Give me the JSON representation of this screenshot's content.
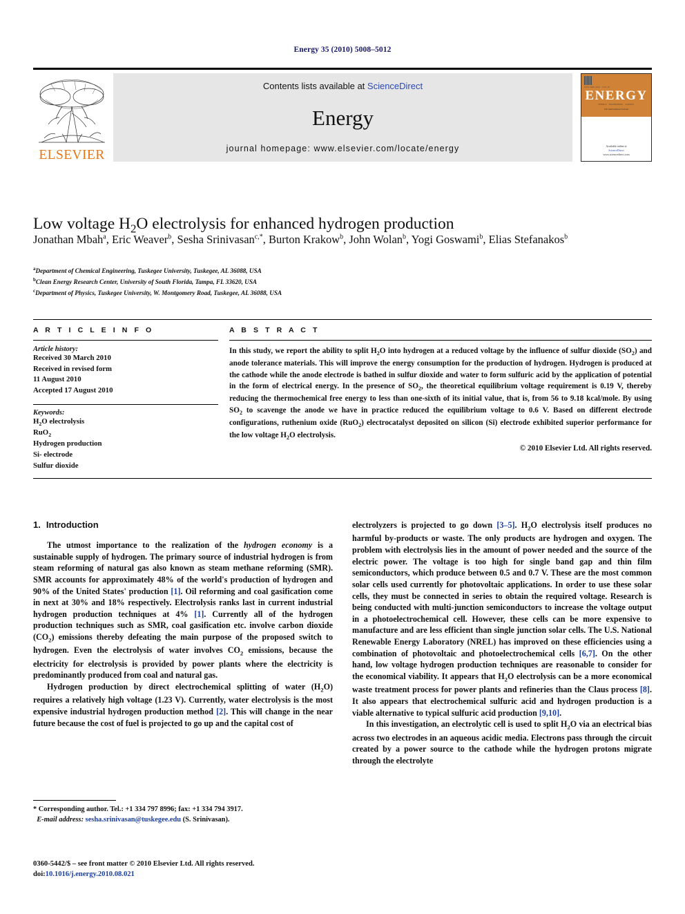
{
  "running_head": "Energy 35 (2010) 5008–5012",
  "masthead": {
    "publisher": "ELSEVIER",
    "contents_prefix": "Contents lists available at ",
    "contents_link": "ScienceDirect",
    "journal_title": "Energy",
    "homepage": "journal homepage: www.elsevier.com/locate/energy",
    "cover": {
      "title": "ENERGY",
      "tagline": "The International Journal",
      "sd_label": "Available online at",
      "sd_brand": "ScienceDirect",
      "sd_url": "www.sciencedirect.com"
    }
  },
  "article": {
    "title_part1": "Low voltage H",
    "title_sub": "2",
    "title_part2": "O electrolysis for enhanced hydrogen production",
    "authors": [
      {
        "name": "Jonathan Mbah",
        "marks": "a",
        "sep": ", "
      },
      {
        "name": "Eric Weaver",
        "marks": "b",
        "sep": ", "
      },
      {
        "name": "Sesha Srinivasan",
        "marks": "c,*",
        "sep": ", "
      },
      {
        "name": "Burton Krakow",
        "marks": "b",
        "sep": ", "
      },
      {
        "name": "John Wolan",
        "marks": "b",
        "sep": ", "
      },
      {
        "name": "Yogi Goswami",
        "marks": "b",
        "sep": ", "
      },
      {
        "name": "Elias Stefanakos",
        "marks": "b",
        "sep": ""
      }
    ],
    "affiliations": [
      {
        "mark": "a",
        "text": "Department of Chemical Engineering, Tuskegee University, Tuskegee, AL 36088, USA"
      },
      {
        "mark": "b",
        "text": "Clean Energy Research Center, University of South Florida, Tampa, FL 33620, USA"
      },
      {
        "mark": "c",
        "text": "Department of Physics, Tuskegee University, W. Montgomery Road, Tuskegee, AL 36088, USA"
      }
    ]
  },
  "article_info": {
    "heading": "A R T I C L E  I N F O",
    "history_label": "Article history:",
    "history_lines": [
      "Received 30 March 2010",
      "Received in revised form",
      "11 August 2010",
      "Accepted 17 August 2010"
    ],
    "keywords_label": "Keywords:",
    "keywords": [
      "H2O electrolysis",
      "RuO2",
      "Hydrogen production",
      "Si- electrode",
      "Sulfur dioxide"
    ]
  },
  "abstract": {
    "heading": "A B S T R A C T",
    "text": "In this study, we report the ability to split H2O into hydrogen at a reduced voltage by the influence of sulfur dioxide (SO2) and anode tolerance materials. This will improve the energy consumption for the production of hydrogen. Hydrogen is produced at the cathode while the anode electrode is bathed in sulfur dioxide and water to form sulfuric acid by the application of potential in the form of electrical energy. In the presence of SO2, the theoretical equilibrium voltage requirement is 0.19 V, thereby reducing the thermochemical free energy to less than one-sixth of its initial value, that is, from 56 to 9.18 kcal/mole. By using SO2 to scavenge the anode we have in practice reduced the equilibrium voltage to 0.6 V. Based on different electrode configurations, ruthenium oxide (RuO2) electrocatalyst deposited on silicon (Si) electrode exhibited superior performance for the low voltage H2O electrolysis.",
    "copyright": "© 2010 Elsevier Ltd. All rights reserved."
  },
  "body": {
    "section_number": "1.",
    "section_title": "Introduction",
    "left_paragraphs": [
      "The utmost importance to the realization of the hydrogen economy is a sustainable supply of hydrogen. The primary source of industrial hydrogen is from steam reforming of natural gas also known as steam methane reforming (SMR). SMR accounts for approximately 48% of the world's production of hydrogen and 90% of the United States' production [1]. Oil reforming and coal gasification come in next at 30% and 18% respectively. Electrolysis ranks last in current industrial hydrogen production techniques at 4% [1]. Currently all of the hydrogen production techniques such as SMR, coal gasification etc. involve carbon dioxide (CO2) emissions thereby defeating the main purpose of the proposed switch to hydrogen. Even the electrolysis of water involves CO2 emissions, because the electricity for electrolysis is provided by power plants where the electricity is predominantly produced from coal and natural gas.",
      "Hydrogen production by direct electrochemical splitting of water (H2O) requires a relatively high voltage (1.23 V). Currently, water electrolysis is the most expensive industrial hydrogen production method [2]. This will change in the near future because the cost of fuel is projected to go up and the capital cost of"
    ],
    "right_paragraphs": [
      "electrolyzers is projected to go down [3–5]. H2O electrolysis itself produces no harmful by-products or waste. The only products are hydrogen and oxygen. The problem with electrolysis lies in the amount of power needed and the source of the electric power. The voltage is too high for single band gap and thin film semiconductors, which produce between 0.5 and 0.7 V. These are the most common solar cells used currently for photovoltaic applications. In order to use these solar cells, they must be connected in series to obtain the required voltage. Research is being conducted with multi-junction semiconductors to increase the voltage output in a photoelectrochemical cell. However, these cells can be more expensive to manufacture and are less efficient than single junction solar cells. The U.S. National Renewable Energy Laboratory (NREL) has improved on these efficiencies using a combination of photovoltaic and photoelectrochemical cells [6,7]. On the other hand, low voltage hydrogen production techniques are reasonable to consider for the economical viability. It appears that H2O electrolysis can be a more economical waste treatment process for power plants and refineries than the Claus process [8]. It also appears that electrochemical sulfuric acid and hydrogen production is a viable alternative to typical sulfuric acid production [9,10].",
      "In this investigation, an electrolytic cell is used to split H2O via an electrical bias across two electrodes in an aqueous acidic media. Electrons pass through the circuit created by a power source to the cathode while the hydrogen protons migrate through the electrolyte"
    ]
  },
  "footnotes": {
    "corresponding": "* Corresponding author. Tel.: +1 334 797 8996; fax: +1 334 794 3917.",
    "email_label": "E-mail address:",
    "email": "sesha.srinivasan@tuskegee.edu",
    "email_suffix": " (S. Srinivasan)."
  },
  "imprint": {
    "line1": "0360-5442/$ – see front matter © 2010 Elsevier Ltd. All rights reserved.",
    "doi_label": "doi:",
    "doi": "10.1016/j.energy.2010.08.021"
  },
  "colors": {
    "link": "#1c3fa0",
    "running_head": "#17176b",
    "elsevier_orange": "#e87511",
    "masthead_bg": "#e6e6e6"
  }
}
